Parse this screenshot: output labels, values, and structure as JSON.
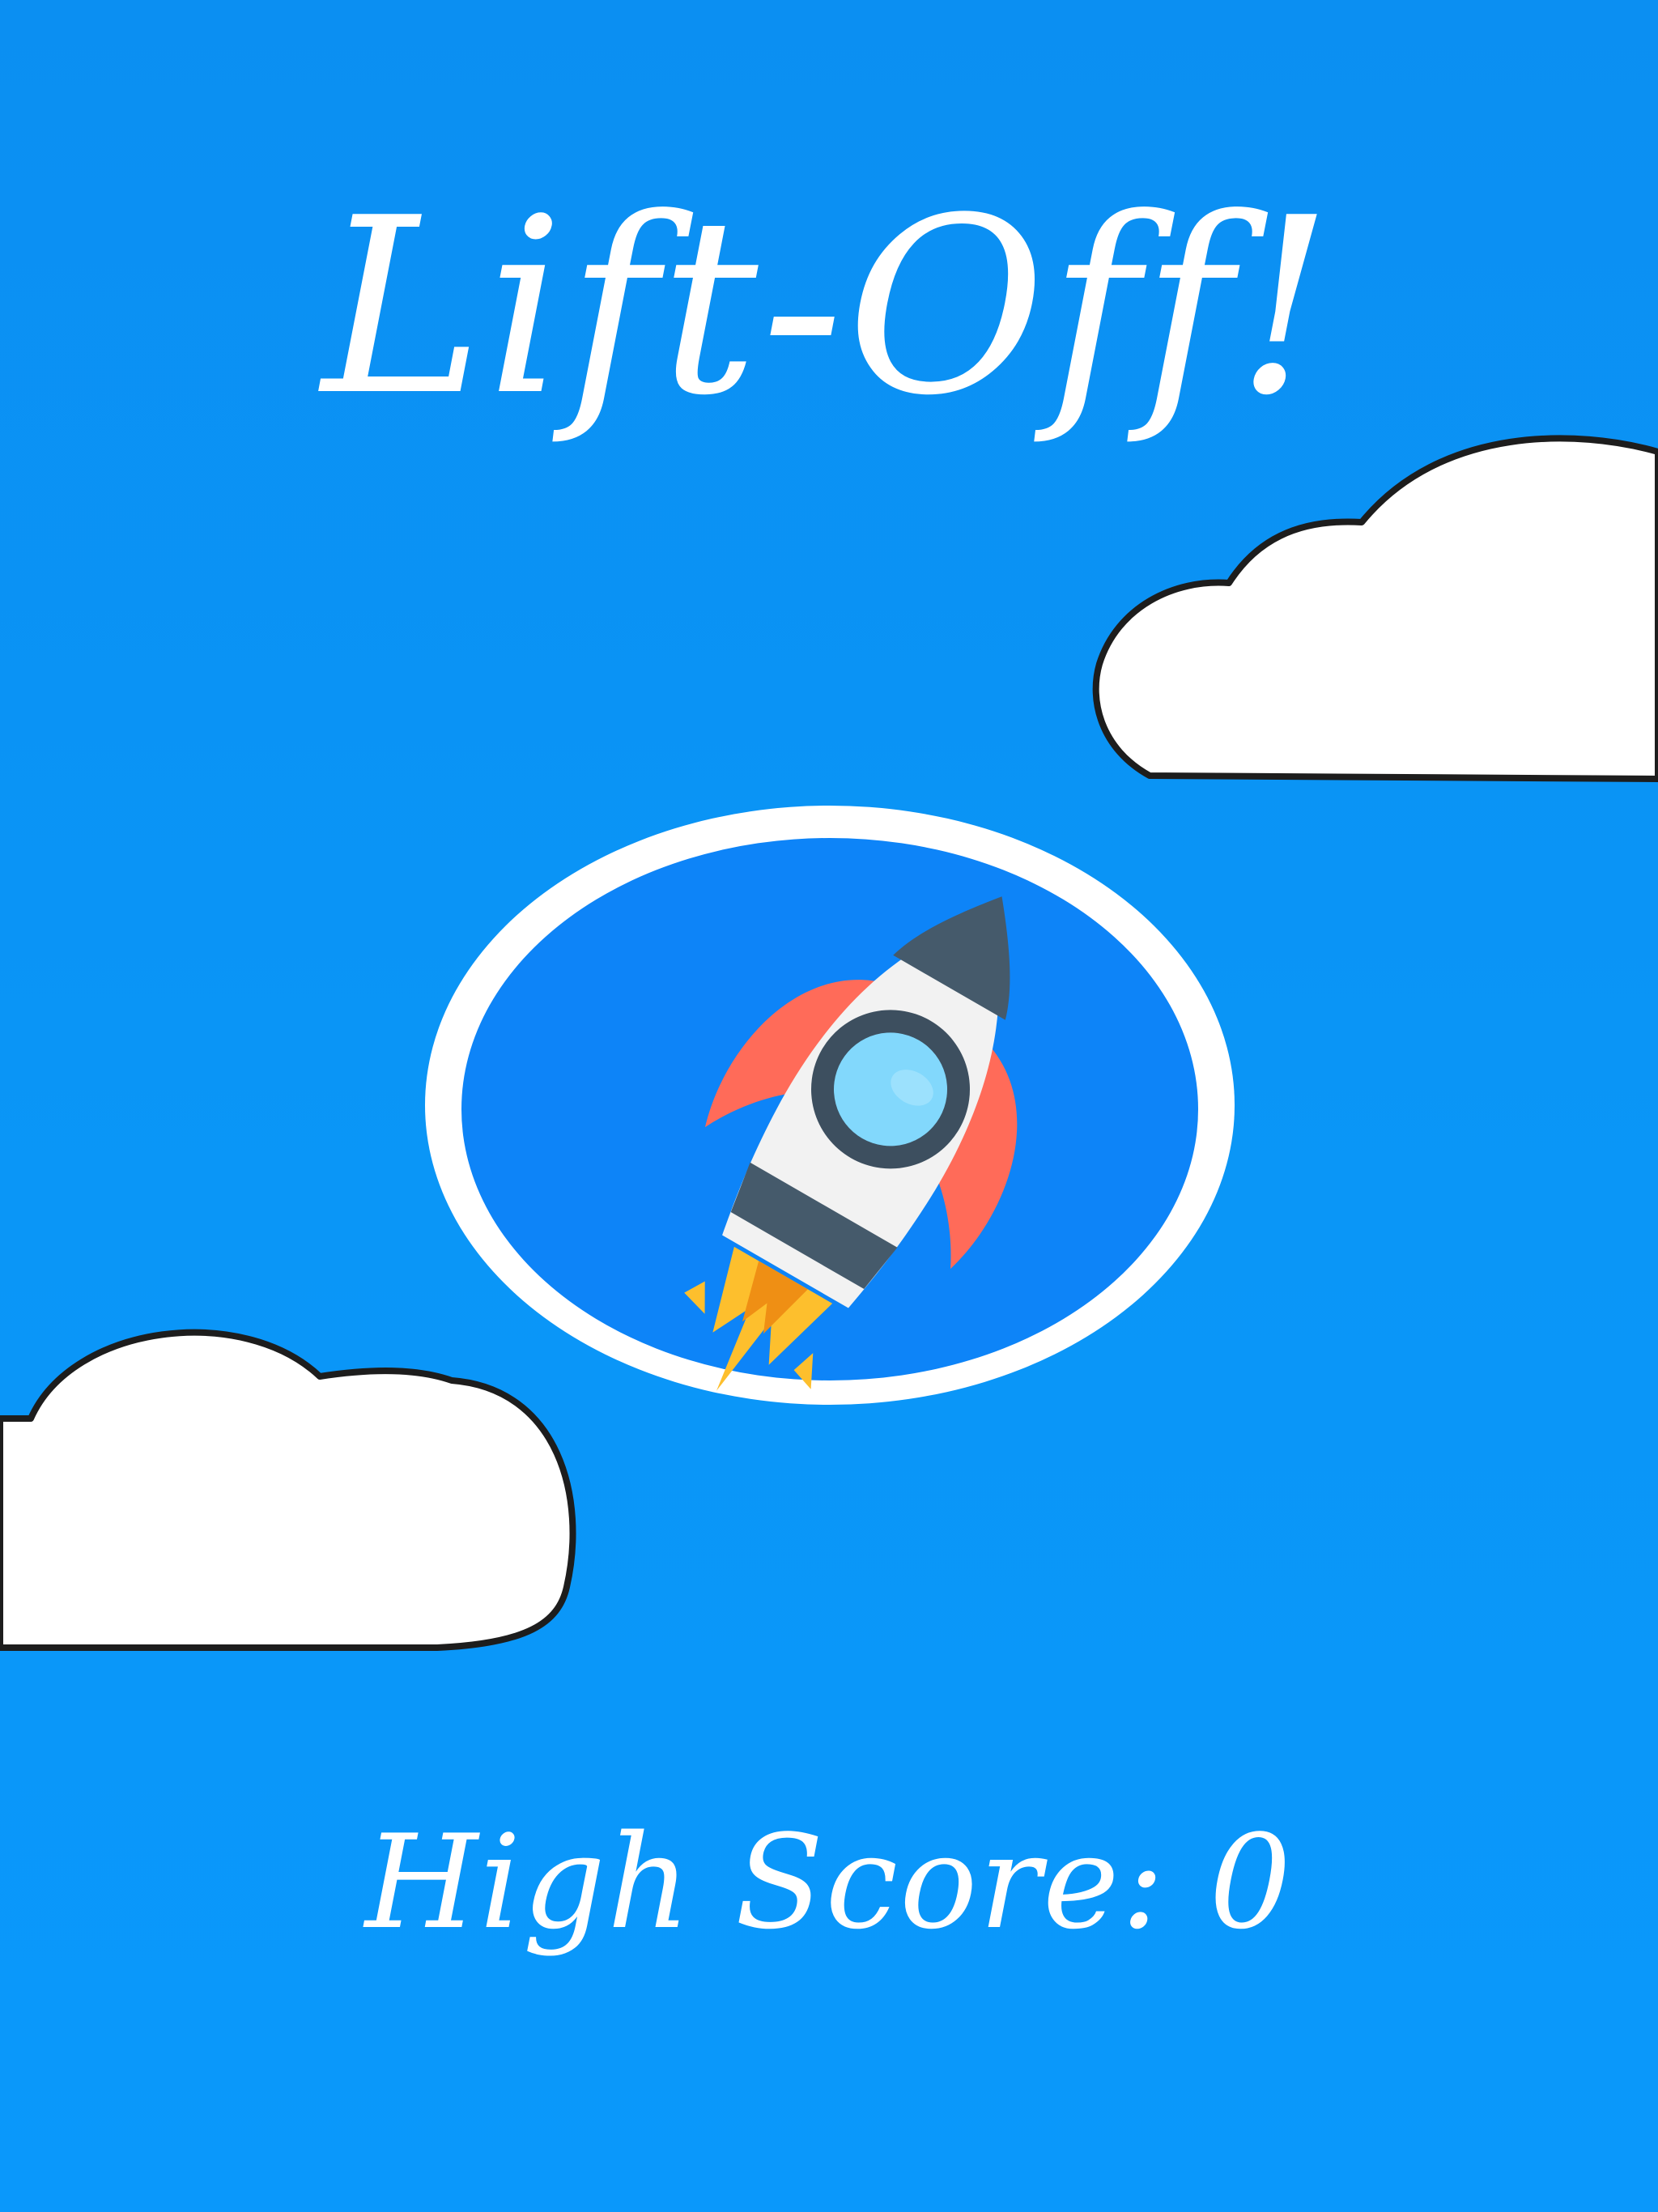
{
  "app": {
    "title": "Lift-Off!"
  },
  "high_score": {
    "label": "High Score:",
    "value": "0"
  },
  "logo": {
    "icon": "rocket-icon"
  },
  "colors": {
    "sky": "#0a96f7",
    "badge_fill": "#0d84f8",
    "badge_ring": "#ffffff",
    "text": "#ffffff",
    "cloud_fill": "#ffffff",
    "cloud_outline": "#1d1d1d",
    "rocket_body": "#f2f2f2",
    "rocket_dark": "#455a6b",
    "rocket_fin": "#ff6b59",
    "rocket_window": "#82d8fc",
    "flame_outer": "#fdbf2d",
    "flame_inner": "#ef8f14"
  }
}
